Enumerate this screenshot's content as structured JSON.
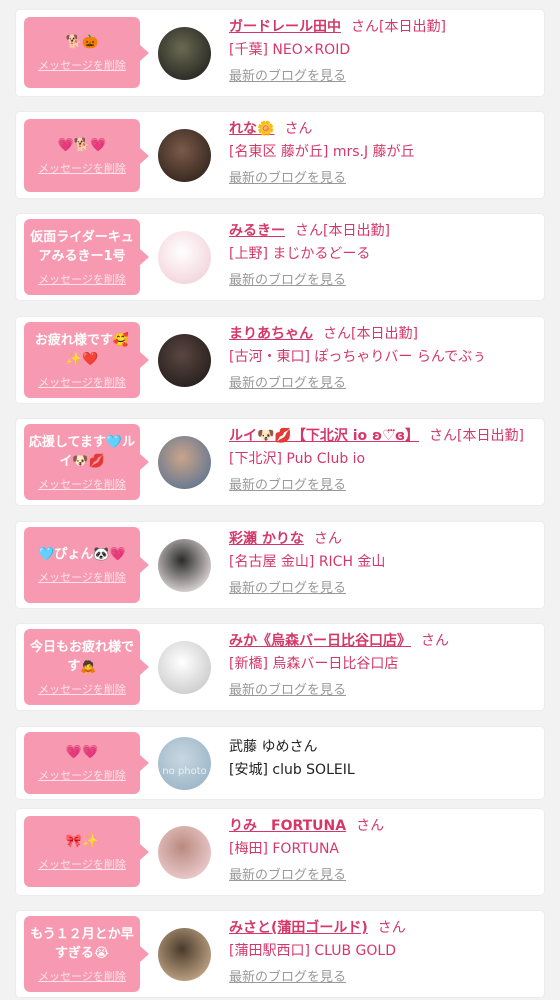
{
  "delete_label": "メッセージを削除",
  "blog_label": "最新のブログを見る",
  "items": [
    {
      "message": "🐕🎃",
      "name": "ガードレール田中",
      "suffix": "さん[本日出勤]",
      "shop": "[千葉] NEO×ROID",
      "avatar_colors": [
        "#2c2c26",
        "#6a6a52"
      ]
    },
    {
      "message": "💗🐕💗",
      "name": "れな🌼",
      "suffix": "さん",
      "shop": "[名東区 藤が丘] mrs.J 藤が丘",
      "avatar_colors": [
        "#3a2a22",
        "#7a5a48"
      ]
    },
    {
      "message": "仮面ライダーキュアみるきー1号",
      "name": "みるきー",
      "suffix": "さん[本日出勤]",
      "shop": "[上野] まじかるどーる",
      "avatar_colors": [
        "#f3d6de",
        "#ffffff"
      ]
    },
    {
      "message": "お疲れ様です🥰✨❤️",
      "name": "まりあちゃん",
      "suffix": "さん[本日出勤]",
      "shop": "[古河・東口] ぽっちゃりバー らんでぶぅ",
      "avatar_colors": [
        "#2a2220",
        "#5a4640"
      ]
    },
    {
      "message": "応援してます🩵ルイ🐶💋",
      "name": "ルイ🐶💋【下北沢 io ʚ♡⃛ɞ】",
      "suffix": "さん[本日出勤]",
      "shop": "[下北沢] Pub Club io",
      "avatar_colors": [
        "#6a7a90",
        "#c9a48a"
      ]
    },
    {
      "message": "🩵ぴょん🐼💗",
      "name": "彩瀬 かりな",
      "suffix": "さん",
      "shop": "[名古屋 金山] RICH 金山",
      "avatar_colors": [
        "#d8d0d0",
        "#2a2a2a"
      ]
    },
    {
      "message": "今日もお疲れ様です🙇",
      "name": "みか《烏森バー日比谷口店》",
      "suffix": "さん",
      "shop": "[新橋] 烏森バー日比谷口店",
      "avatar_colors": [
        "#cfcfcf",
        "#ffffff"
      ]
    },
    {
      "message": "💗💗",
      "name": "武藤 ゆめさん",
      "suffix": "",
      "shop": "[安城] club SOLEIL",
      "plain": true,
      "nophoto": "no photo",
      "avatar_colors": [
        "#9fb8c8",
        "#c9d8e2"
      ]
    },
    {
      "message": "🎀✨",
      "name": "りみ　FORTUNA",
      "suffix": "さん",
      "shop": "[梅田] FORTUNA",
      "avatar_colors": [
        "#e9c7c9",
        "#b98a7e"
      ]
    },
    {
      "message": "もう１２月とか早すぎる😭",
      "name": "みさと(蒲田ゴールド)",
      "suffix": "さん",
      "shop": "[蒲田駅西口] CLUB GOLD",
      "avatar_colors": [
        "#bba080",
        "#4a3a2c"
      ]
    }
  ]
}
